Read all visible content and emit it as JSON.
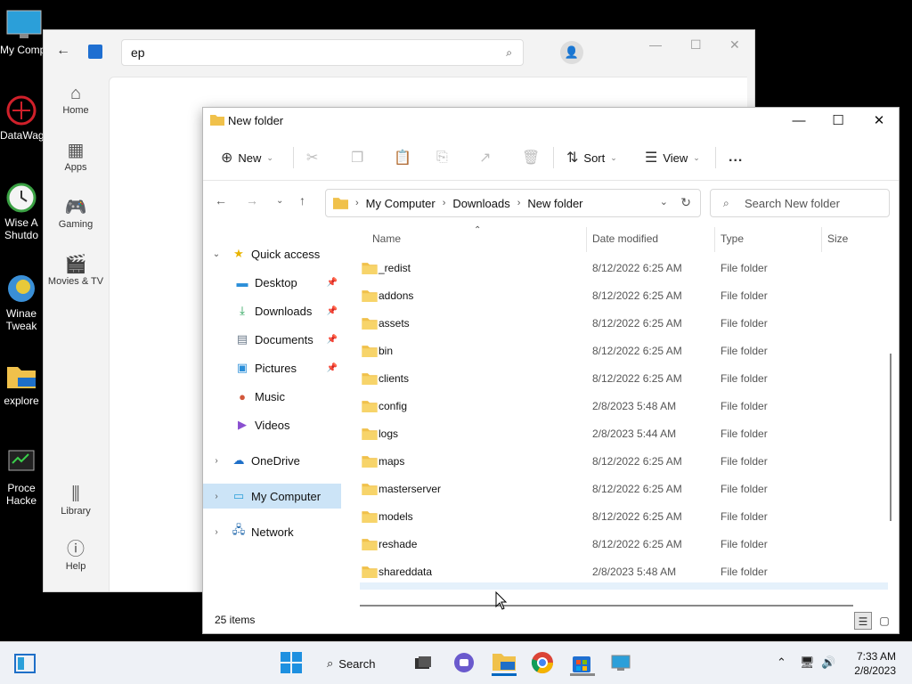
{
  "desktop": {
    "icons": [
      {
        "label": "My Comp",
        "icon": "computer-icon"
      },
      {
        "label": "DataWag",
        "icon": "app-icon"
      },
      {
        "label": "Wise A\nShutdo",
        "icon": "clock-icon"
      },
      {
        "label": "Winae\nTweak",
        "icon": "tweak-icon"
      },
      {
        "label": "explore",
        "icon": "folder-icon"
      },
      {
        "label": "Proce\nHacke",
        "icon": "monitor-icon"
      }
    ]
  },
  "store": {
    "search_value": "ep",
    "rail": [
      {
        "label": "Home",
        "icon": "home-icon"
      },
      {
        "label": "Apps",
        "icon": "apps-icon"
      },
      {
        "label": "Gaming",
        "icon": "gamepad-icon"
      },
      {
        "label": "Movies & TV",
        "icon": "film-icon"
      }
    ],
    "library_label": "Library",
    "help_label": "Help"
  },
  "explorer": {
    "title": "New folder",
    "toolbar": {
      "new_label": "New",
      "sort_label": "Sort",
      "view_label": "View",
      "more_label": "..."
    },
    "breadcrumb": [
      "My Computer",
      "Downloads",
      "New folder"
    ],
    "search_placeholder": "Search New folder",
    "nav": {
      "quick_access": "Quick access",
      "items": [
        {
          "label": "Desktop",
          "icon": "desktop-icon",
          "pinned": true
        },
        {
          "label": "Downloads",
          "icon": "download-icon",
          "pinned": true
        },
        {
          "label": "Documents",
          "icon": "documents-icon",
          "pinned": true
        },
        {
          "label": "Pictures",
          "icon": "pictures-icon",
          "pinned": true
        },
        {
          "label": "Music",
          "icon": "music-icon",
          "pinned": false
        },
        {
          "label": "Videos",
          "icon": "videos-icon",
          "pinned": false
        }
      ],
      "onedrive": "OneDrive",
      "my_computer": "My Computer",
      "network": "Network"
    },
    "columns": {
      "name": "Name",
      "date": "Date modified",
      "type": "Type",
      "size": "Size"
    },
    "files": [
      {
        "name": "_redist",
        "date": "8/12/2022 6:25 AM",
        "type": "File folder"
      },
      {
        "name": "addons",
        "date": "8/12/2022 6:25 AM",
        "type": "File folder"
      },
      {
        "name": "assets",
        "date": "8/12/2022 6:25 AM",
        "type": "File folder"
      },
      {
        "name": "bin",
        "date": "8/12/2022 6:25 AM",
        "type": "File folder"
      },
      {
        "name": "clients",
        "date": "8/12/2022 6:25 AM",
        "type": "File folder"
      },
      {
        "name": "config",
        "date": "2/8/2023 5:48 AM",
        "type": "File folder"
      },
      {
        "name": "logs",
        "date": "2/8/2023 5:44 AM",
        "type": "File folder"
      },
      {
        "name": "maps",
        "date": "8/12/2022 6:25 AM",
        "type": "File folder"
      },
      {
        "name": "masterserver",
        "date": "8/12/2022 6:25 AM",
        "type": "File folder"
      },
      {
        "name": "models",
        "date": "8/12/2022 6:25 AM",
        "type": "File folder"
      },
      {
        "name": "reshade",
        "date": "8/12/2022 6:25 AM",
        "type": "File folder"
      },
      {
        "name": "shareddata",
        "date": "2/8/2023 5:48 AM",
        "type": "File folder"
      }
    ],
    "status": "25 items"
  },
  "taskbar": {
    "search_label": "Search",
    "time": "7:33 AM",
    "date": "2/8/2023"
  },
  "colors": {
    "accent": "#0067c0",
    "folder": "#f0c14b",
    "selection": "#cce4f7"
  }
}
